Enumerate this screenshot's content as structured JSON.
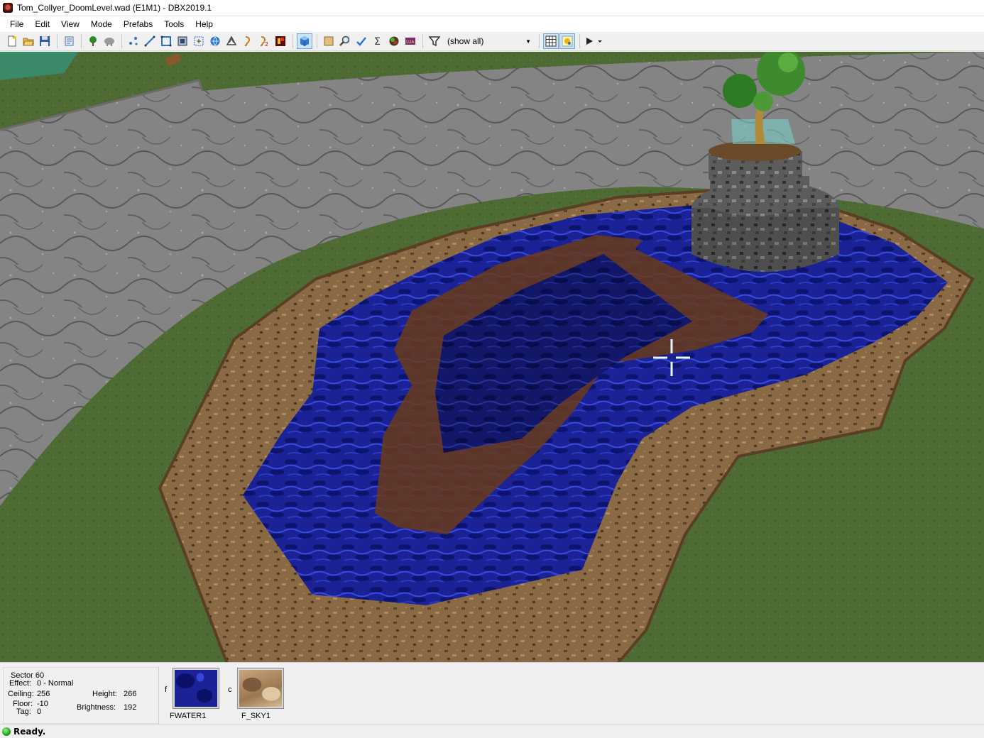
{
  "window": {
    "title": "Tom_Collyer_DoomLevel.wad (E1M1) - DBX2019.1"
  },
  "menu": {
    "items": [
      "File",
      "Edit",
      "View",
      "Mode",
      "Prefabs",
      "Tools",
      "Help"
    ]
  },
  "toolbar": {
    "filter_value": "(show all)",
    "buttons": [
      "new-file-icon",
      "open-folder-icon",
      "save-icon",
      "script-icon",
      "tree-icon",
      "cloud-icon",
      "vertices-icon",
      "linedefs-icon",
      "sidedefs-icon",
      "sectors-icon",
      "things-icon",
      "globe-icon",
      "texture-icon",
      "sound-icon",
      "sound-alt-icon",
      "map-icon",
      "3d-cube-icon",
      "box-select-icon",
      "zoom-icon",
      "check-icon",
      "sigma-icon",
      "ball-icon",
      "lua-icon",
      "filter-icon",
      "grid-icon",
      "snap-icon",
      "play-icon"
    ]
  },
  "sector_info": {
    "sector": "Sector 60",
    "effect_label": "Effect:",
    "effect_value": "0 - Normal",
    "ceiling_label": "Ceiling:",
    "ceiling_value": "256",
    "floor_label": "Floor:",
    "floor_value": "-10",
    "tag_label": "Tag:",
    "tag_value": "0",
    "height_label": "Height:",
    "height_value": "266",
    "brightness_label": "Brightness:",
    "brightness_value": "192"
  },
  "textures": {
    "floor_code": "f",
    "floor_name": "FWATER1",
    "ceiling_code": "c",
    "ceiling_name": "F_SKY1"
  },
  "status": {
    "text": "Ready."
  },
  "colors": {
    "grass": "#4e6b33",
    "stone": "#8c8c8c",
    "dirt": "#8a6a45",
    "water": "#1a2aa0",
    "brown_path": "#6a3a1a",
    "crosshair": "#e8f6ff"
  }
}
